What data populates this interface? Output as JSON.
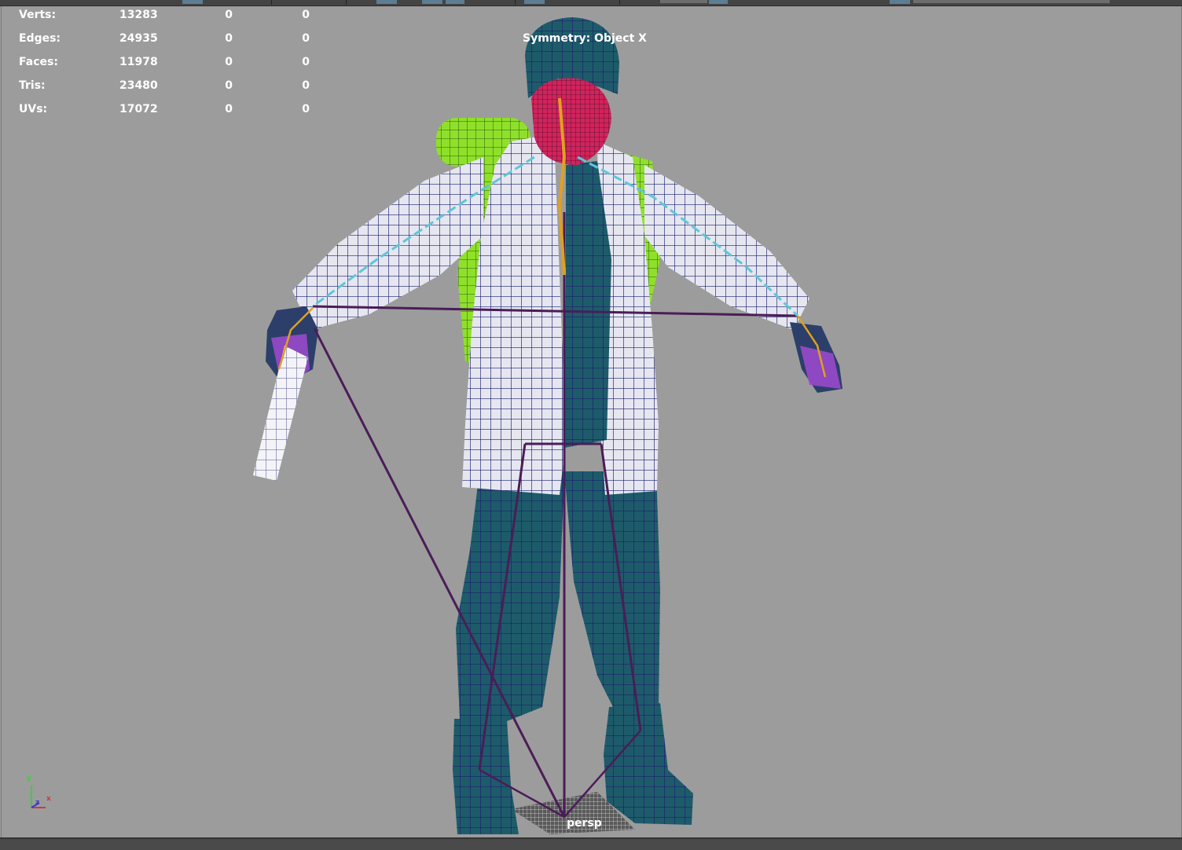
{
  "hud": {
    "rows": [
      {
        "label": "Verts:",
        "total": "13283",
        "selected": "0",
        "lit": "0"
      },
      {
        "label": "Edges:",
        "total": "24935",
        "selected": "0",
        "lit": "0"
      },
      {
        "label": "Faces:",
        "total": "11978",
        "selected": "0",
        "lit": "0"
      },
      {
        "label": "Tris:",
        "total": "23480",
        "selected": "0",
        "lit": "0"
      },
      {
        "label": "UVs:",
        "total": "17072",
        "selected": "0",
        "lit": "0"
      }
    ]
  },
  "viewport": {
    "symmetry_label": "Symmetry: Object X",
    "camera_label": "persp",
    "background_color": "#9c9c9c"
  },
  "axis_gizmo": {
    "y": "y",
    "z": "z",
    "x": "x"
  },
  "colors": {
    "mesh_body": "#1e5b6a",
    "coat": "#e6e6f0",
    "wire": "#1a1f6e",
    "backpack": "#8fe02a",
    "face": "#d0245c",
    "joint": "#4a1d57",
    "bone_arm": "#5ec6d8",
    "bone_spine": "#e0a020"
  }
}
